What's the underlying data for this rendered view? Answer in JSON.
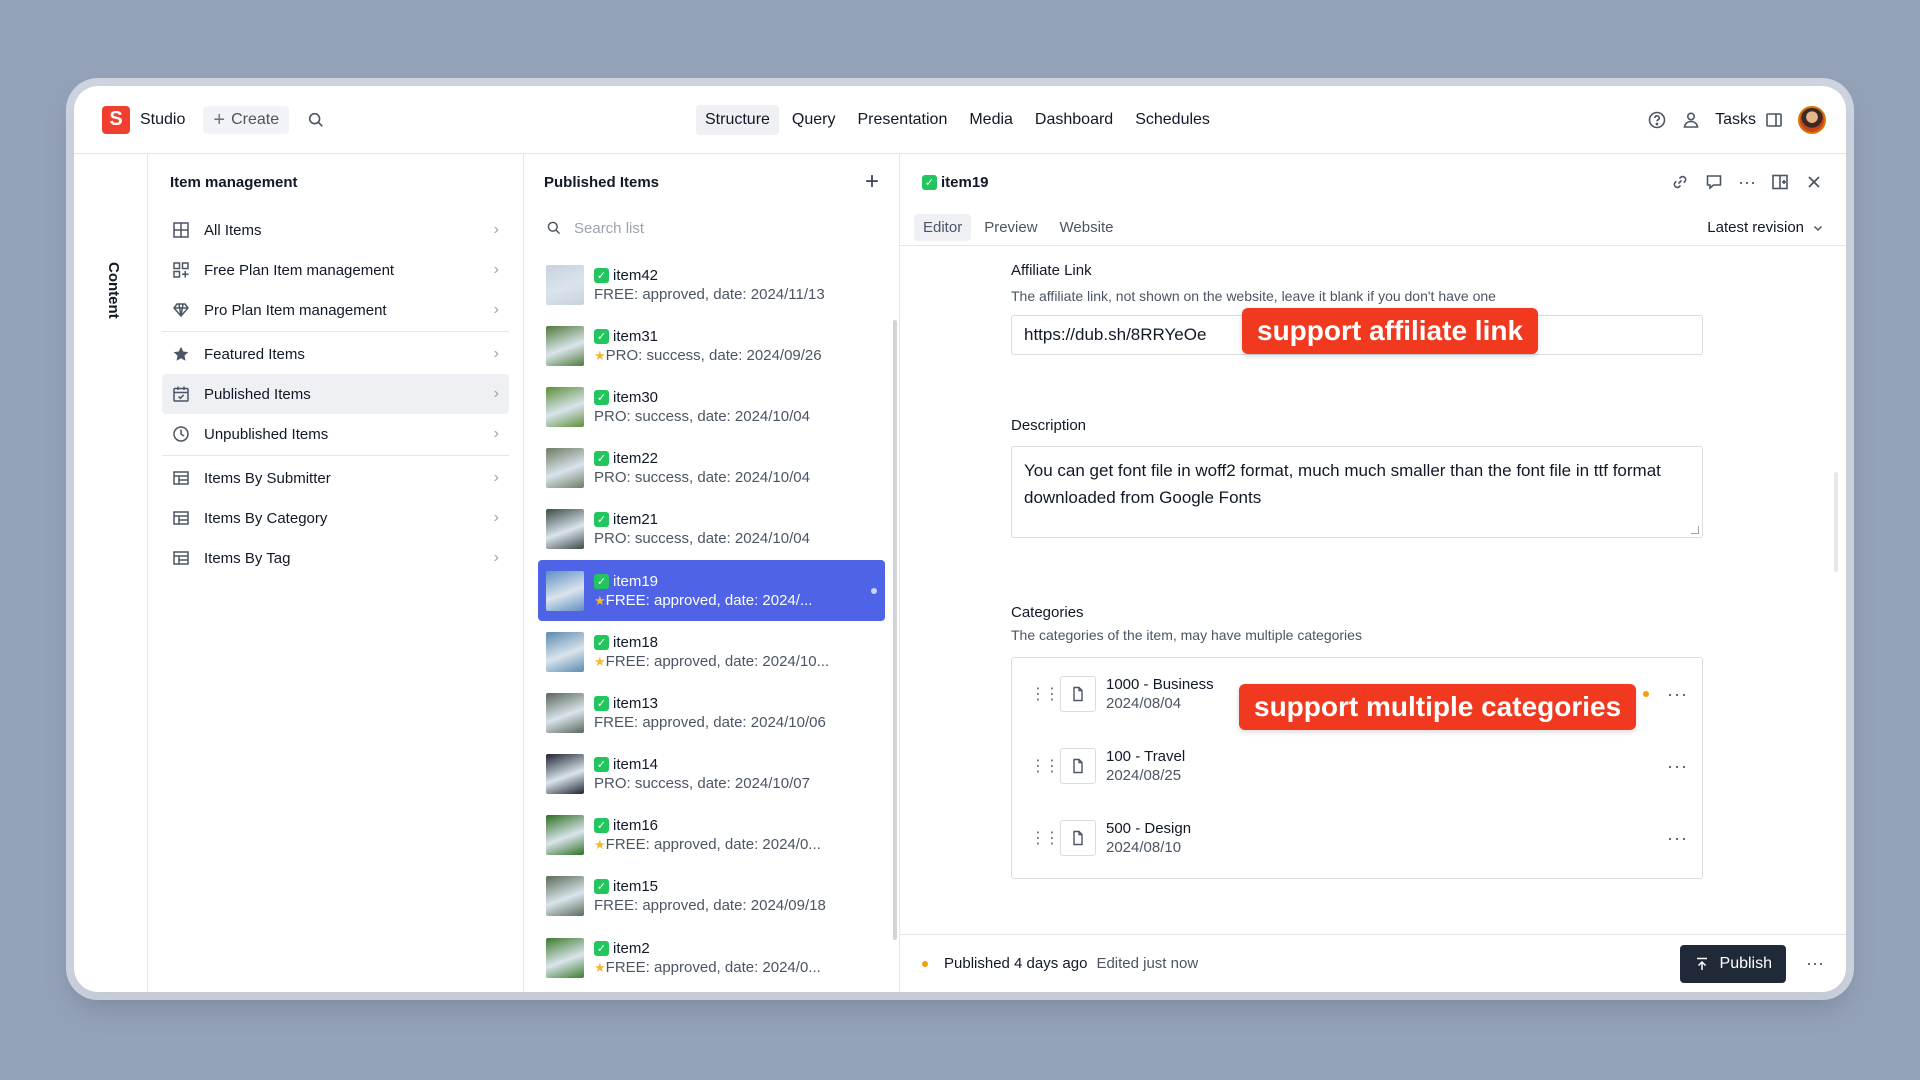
{
  "app": {
    "logo_letter": "S",
    "title": "Studio",
    "create_label": "Create"
  },
  "nav": [
    "Structure",
    "Query",
    "Presentation",
    "Media",
    "Dashboard",
    "Schedules"
  ],
  "topbar": {
    "tasks_label": "Tasks"
  },
  "rail": {
    "label": "Content"
  },
  "sidebar": {
    "title": "Item management",
    "items": [
      {
        "label": "All Items",
        "icon": "grid-icon"
      },
      {
        "label": "Free Plan Item management",
        "icon": "apps-icon"
      },
      {
        "label": "Pro Plan Item management",
        "icon": "diamond-icon"
      },
      {
        "label": "Featured Items",
        "icon": "star-icon"
      },
      {
        "label": "Published Items",
        "icon": "calendar-icon",
        "active": true
      },
      {
        "label": "Unpublished Items",
        "icon": "clock-icon"
      },
      {
        "label": "Items By Submitter",
        "icon": "table-icon"
      },
      {
        "label": "Items By Category",
        "icon": "table-icon"
      },
      {
        "label": "Items By Tag",
        "icon": "table-icon"
      }
    ]
  },
  "list": {
    "title": "Published Items",
    "search_placeholder": "Search list",
    "items": [
      {
        "title": "item42",
        "subtitle": "FREE: approved, date: 2024/11/13",
        "starred": false,
        "color": "#c7d2de"
      },
      {
        "title": "item31",
        "subtitle": "PRO: success, date: 2024/09/26",
        "starred": true,
        "color": "#4f7a3a"
      },
      {
        "title": "item30",
        "subtitle": "PRO: success, date: 2024/10/04",
        "starred": false,
        "color": "#5c8f3a"
      },
      {
        "title": "item22",
        "subtitle": "PRO: success, date: 2024/10/04",
        "starred": false,
        "color": "#6e7b62"
      },
      {
        "title": "item21",
        "subtitle": "PRO: success, date: 2024/10/04",
        "starred": false,
        "color": "#3c4a48"
      },
      {
        "title": "item19",
        "subtitle": "FREE: approved, date: 2024/...",
        "starred": true,
        "color": "#5f8fc2",
        "selected": true
      },
      {
        "title": "item18",
        "subtitle": "FREE: approved, date: 2024/10...",
        "starred": true,
        "color": "#5b8ab0"
      },
      {
        "title": "item13",
        "subtitle": "FREE: approved, date: 2024/10/06",
        "starred": false,
        "color": "#59665a"
      },
      {
        "title": "item14",
        "subtitle": "PRO: success, date: 2024/10/07",
        "starred": false,
        "color": "#1f2430"
      },
      {
        "title": "item16",
        "subtitle": "FREE: approved, date: 2024/0...",
        "starred": true,
        "color": "#2f6f22"
      },
      {
        "title": "item15",
        "subtitle": "FREE: approved, date: 2024/09/18",
        "starred": false,
        "color": "#5a6b58"
      },
      {
        "title": "item2",
        "subtitle": "FREE: approved, date: 2024/0...",
        "starred": true,
        "color": "#3d7b2c"
      }
    ]
  },
  "document": {
    "title": "item19",
    "tabs": [
      "Editor",
      "Preview",
      "Website"
    ],
    "revision_label": "Latest revision",
    "affiliate": {
      "label": "Affiliate Link",
      "description": "The affiliate link, not shown on the website, leave it blank if you don't have one",
      "value": "https://dub.sh/8RRYeOe"
    },
    "description_field": {
      "label": "Description",
      "value": "You can get font file in woff2 format, much much smaller than the font file in ttf format downloaded from Google Fonts"
    },
    "categories": {
      "label": "Categories",
      "description": "The categories of the item, may have multiple categories",
      "items": [
        {
          "name": "1000 - Business",
          "date": "2024/08/04",
          "changed": true
        },
        {
          "name": "100 - Travel",
          "date": "2024/08/25",
          "changed": false
        },
        {
          "name": "500 - Design",
          "date": "2024/08/10",
          "changed": false
        }
      ]
    },
    "footer": {
      "published": "Published 4 days ago",
      "edited": "Edited just now",
      "publish_label": "Publish"
    }
  },
  "callouts": {
    "affiliate": "support affiliate link",
    "categories": "support multiple categories"
  },
  "colors": {
    "accent": "#4f63e6",
    "brand": "#f03e2f",
    "callout": "#f0391f",
    "check": "#22c55e",
    "background": "#95a3ba"
  }
}
